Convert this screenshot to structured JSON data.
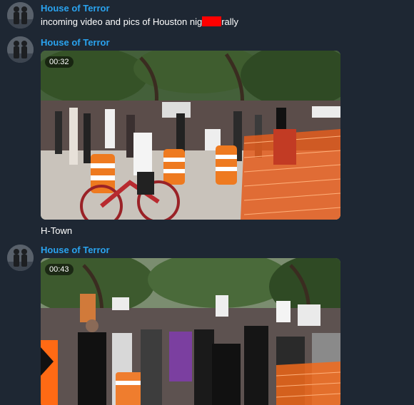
{
  "messages": [
    {
      "sender": "House of Terror",
      "text_before": "incoming video and pics of Houston nig",
      "text_after": "rally"
    },
    {
      "sender": "House of Terror",
      "video_duration": "00:32",
      "caption": "H-Town"
    },
    {
      "sender": "House of Terror",
      "video_duration": "00:43"
    }
  ],
  "colors": {
    "background": "#1e2733",
    "sender_name": "#2aa3ef",
    "text": "#ffffff",
    "redaction": "#ff0000"
  }
}
